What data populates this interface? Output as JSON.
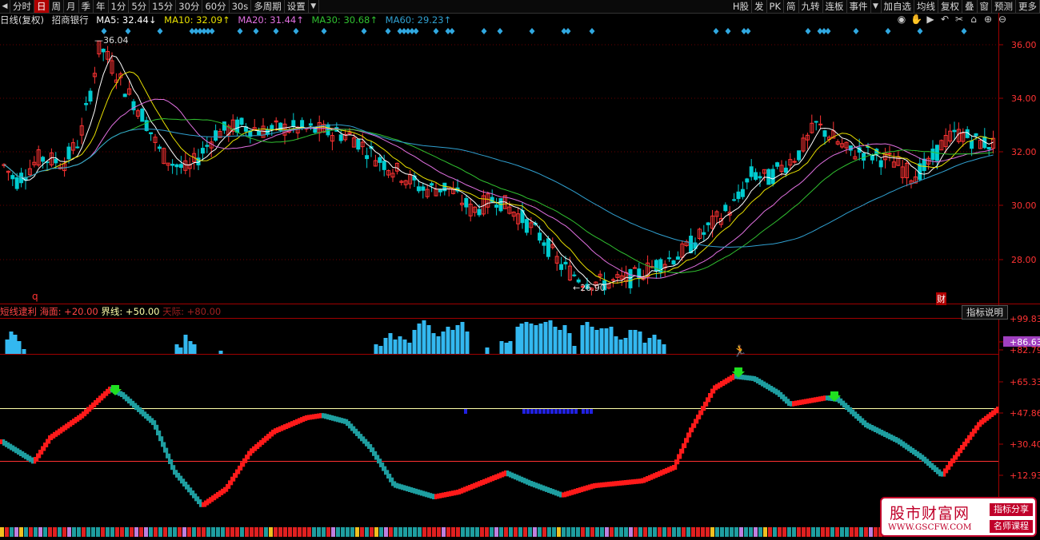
{
  "toolbar": {
    "left": [
      "分时",
      "日",
      "周",
      "月",
      "季",
      "年",
      "1分",
      "5分",
      "15分",
      "30分",
      "60分",
      "30s",
      "多周期",
      "设置"
    ],
    "active_index": 1,
    "right": [
      "H股",
      "发",
      "PK",
      "简",
      "九转",
      "连板",
      "事件",
      "加自选",
      "均线",
      "复权",
      "叠",
      "窗",
      "预测",
      "更多"
    ]
  },
  "info": {
    "cycle": "日线(复权)",
    "stock": "招商银行",
    "ma5": "MA5: 32.44↓",
    "ma10": "MA10: 32.09↑",
    "ma20": "MA20: 31.44↑",
    "ma30": "MA30: 30.68↑",
    "ma60": "MA60: 29.23↑"
  },
  "colors": {
    "up": "#ff3333",
    "down": "#00ccd0",
    "ma5": "#ffffff",
    "ma10": "#e8e000",
    "ma20": "#e070e0",
    "ma30": "#30c030",
    "ma60": "#30a0d0",
    "diamond": "#30a8e0",
    "hist": "#33b8f0",
    "osc_up": "#ff1a1a",
    "osc_down": "#1e9ea0"
  },
  "price_axis": [
    "36.00",
    "34.00",
    "32.00",
    "30.00",
    "28.00"
  ],
  "price_labels": {
    "high": "36.04",
    "low": "26.90"
  },
  "markers": {
    "q": "q",
    "cai": "财"
  },
  "indicator": {
    "name": "短线逮利",
    "sea": "海面: +20.00",
    "bound": "界线: +50.00",
    "sky": "天际: +80.00",
    "button": "指标说明"
  },
  "ind_axis": [
    "+99.83",
    "+86.63",
    "+82.79",
    "+65.33",
    "+47.86",
    "+30.40",
    "+12.93"
  ],
  "watermark": {
    "title": "股市财富网",
    "url": "WWW.GSCFW.COM",
    "tag1": "指标分享",
    "tag2": "名师课程"
  }
}
